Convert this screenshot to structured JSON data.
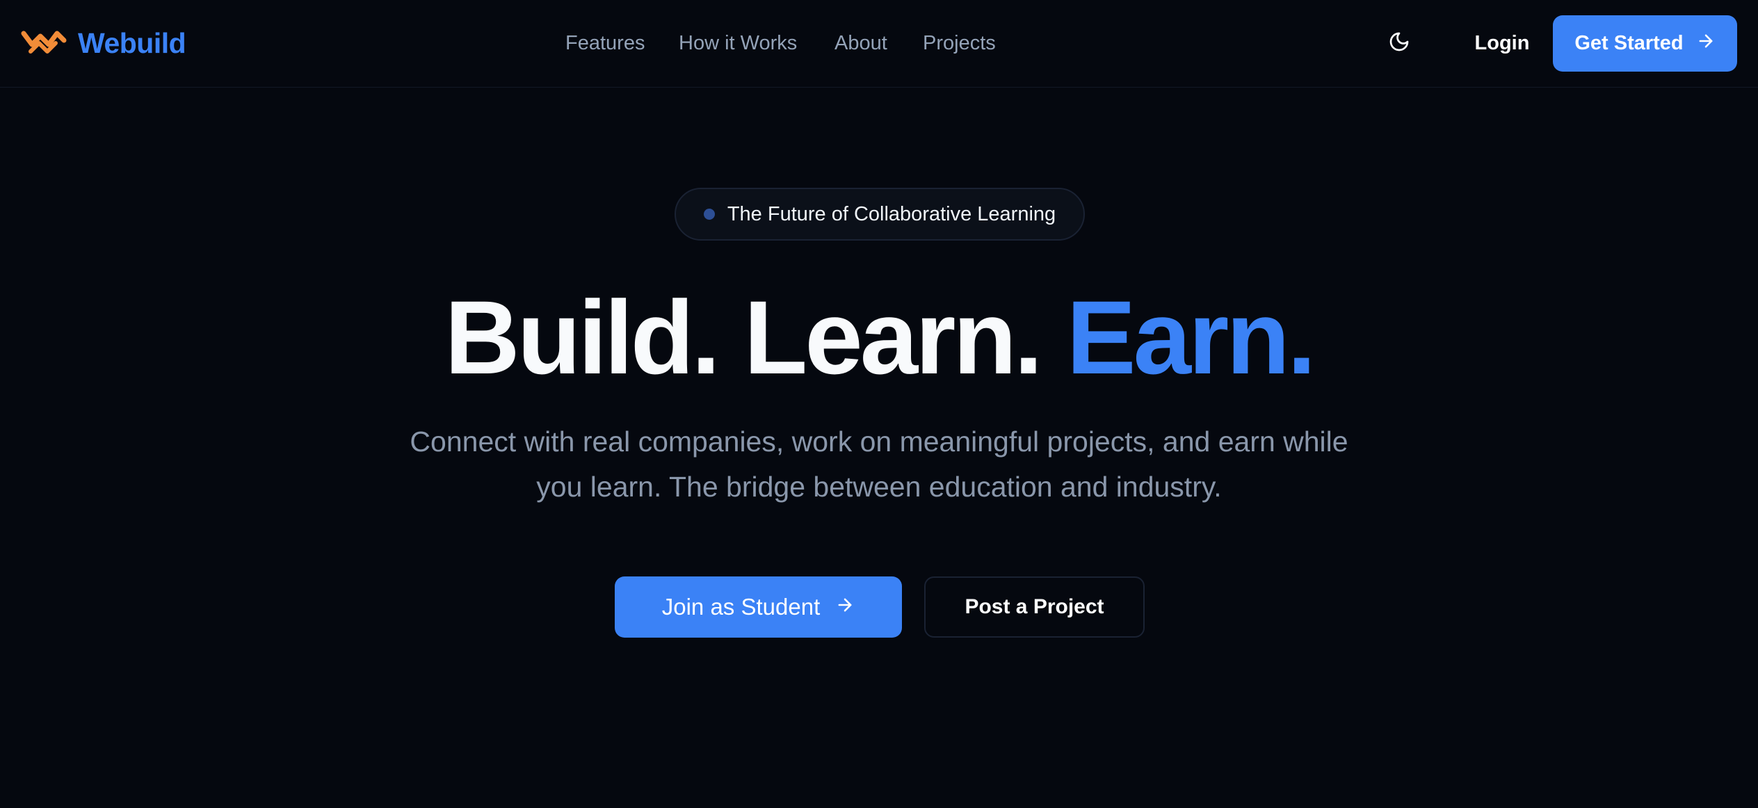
{
  "brand": {
    "name": "Webuild",
    "logo_icon": "zigzag-logo-icon",
    "logo_color": "#f28c38",
    "name_color": "#3b82f6"
  },
  "nav": {
    "items": [
      {
        "label": "Features"
      },
      {
        "label": "How it Works"
      },
      {
        "label": "About"
      },
      {
        "label": "Projects"
      }
    ]
  },
  "header_actions": {
    "theme_toggle_icon": "moon-icon",
    "login_label": "Login",
    "get_started_label": "Get Started",
    "get_started_icon": "arrow-right-icon"
  },
  "hero": {
    "badge_text": "The Future of Collaborative Learning",
    "headline_part1": "Build. Learn.",
    "headline_accent": "Earn.",
    "subtitle": "Connect with real companies, work on meaningful projects, and earn while you learn. The bridge between education and industry.",
    "primary_cta_label": "Join as Student",
    "primary_cta_icon": "arrow-right-icon",
    "secondary_cta_label": "Post a Project"
  },
  "colors": {
    "background": "#05080f",
    "accent": "#3b82f6",
    "muted_text": "#94a3b8",
    "logo_orange": "#f28c38"
  }
}
